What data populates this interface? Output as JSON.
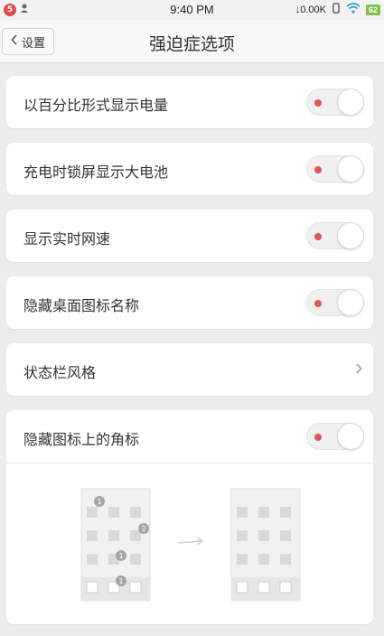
{
  "status_bar": {
    "badge": "5",
    "time": "9:40 PM",
    "net_speed": "↓0.00K",
    "battery": "62"
  },
  "header": {
    "back_label": "设置",
    "title": "强迫症选项"
  },
  "settings": [
    {
      "label": "以百分比形式显示电量",
      "type": "toggle"
    },
    {
      "label": "充电时锁屏显示大电池",
      "type": "toggle"
    },
    {
      "label": "显示实时网速",
      "type": "toggle"
    },
    {
      "label": "隐藏桌面图标名称",
      "type": "toggle"
    },
    {
      "label": "状态栏风格",
      "type": "link"
    },
    {
      "label": "隐藏图标上的角标",
      "type": "toggle"
    }
  ],
  "illustration": {
    "before_badges": [
      "1",
      "2",
      "1",
      "1"
    ]
  },
  "colors": {
    "toggle_dot": "#e0555a",
    "battery": "#7cc04b",
    "notification": "#e04a4a"
  }
}
